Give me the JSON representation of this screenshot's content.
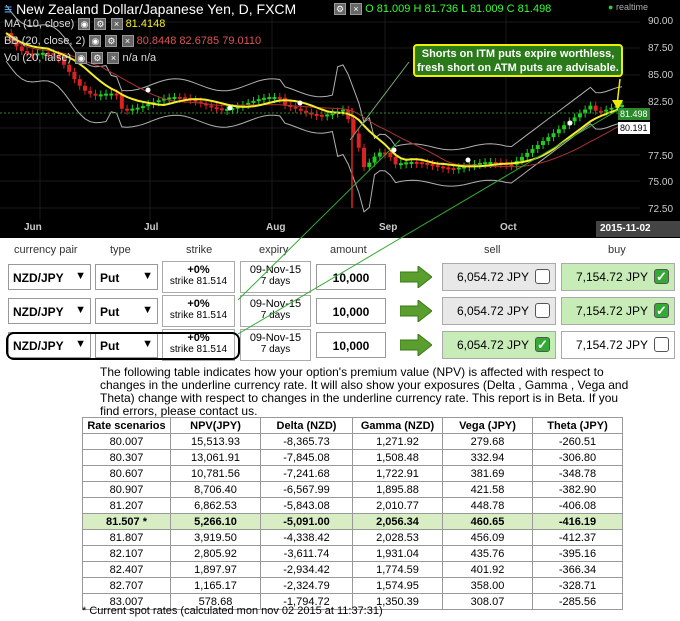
{
  "chart": {
    "title": "New Zealand Dollar/Japanese Yen, D, FXCM",
    "ohlc_o": "O 81.009",
    "ohlc_h": "H 81.736",
    "ohlc_l": "L 81.009",
    "ohlc_c": "C 81.498",
    "realtime": "realtime",
    "legend_ma": "MA (10, close)",
    "legend_ma_val": "81.4148",
    "legend_bb": "BB (20, close, 2)",
    "legend_bb_vals": "80.8448   82.6785  79.0110",
    "legend_vol": "Vol (20, false)",
    "legend_vol_val": "n/a  n/a",
    "annotation": "Shorts on ITM puts expire worthless, fresh short on ATM puts are advisable.",
    "y_ticks": [
      "90.00",
      "87.50",
      "85.00",
      "82.50",
      "77.50",
      "75.00",
      "72.50"
    ],
    "price_tag_last": "81.498",
    "price_tag_ma": "80.191",
    "x_ticks": [
      "Jun",
      "Jul",
      "Aug",
      "Sep",
      "Oct"
    ],
    "date_tag": "2015-11-02",
    "colors": {
      "up": "#22cc22",
      "down": "#dd2222",
      "ma": "#f2ee2a",
      "bb": "#b0b0b0",
      "midband": "#aa3333"
    }
  },
  "options": {
    "headers": {
      "pair": "currency pair",
      "type": "type",
      "strike": "strike",
      "expiry": "expiry",
      "amount": "amount",
      "sell": "sell",
      "buy": "buy"
    },
    "rows": [
      {
        "pair": "NZD/JPY",
        "type": "Put",
        "strike_pct": "+0%",
        "strike": "strike 81.514",
        "expiry": "09-Nov-15",
        "expiry_days": "7 days",
        "amount": "10,000",
        "sell": "6,054.72 JPY",
        "buy": "7,154.72 JPY",
        "sell_checked": false,
        "buy_checked": true
      },
      {
        "pair": "NZD/JPY",
        "type": "Put",
        "strike_pct": "+0%",
        "strike": "strike 81.514",
        "expiry": "09-Nov-15",
        "expiry_days": "7 days",
        "amount": "10,000",
        "sell": "6,054.72 JPY",
        "buy": "7,154.72 JPY",
        "sell_checked": false,
        "buy_checked": true
      },
      {
        "pair": "NZD/JPY",
        "type": "Put",
        "strike_pct": "+0%",
        "strike": "strike 81.514",
        "expiry": "09-Nov-15",
        "expiry_days": "7 days",
        "amount": "10,000",
        "sell": "6,054.72 JPY",
        "buy": "7,154.72 JPY",
        "sell_checked": true,
        "buy_checked": false
      }
    ]
  },
  "description": "The following table indicates how your option's premium value (NPV) is affected with respect to changes in the underline currency rate. It will also show your exposures (Delta , Gamma , Vega and Theta) change with respect to changes in the underline currency rate. This report is in Beta. If you find errors, please contact us.",
  "table": {
    "headers": [
      "Rate scenarios",
      "NPV(JPY)",
      "Delta (NZD)",
      "Gamma (NZD)",
      "Vega (JPY)",
      "Theta (JPY)"
    ],
    "rows": [
      [
        "80.007",
        "15,513.93",
        "-8,365.73",
        "1,271.92",
        "279.68",
        "-260.51"
      ],
      [
        "80.307",
        "13,061.91",
        "-7,845.08",
        "1,508.48",
        "332.94",
        "-306.80"
      ],
      [
        "80.607",
        "10,781.56",
        "-7,241.68",
        "1,722.91",
        "381.69",
        "-348.78"
      ],
      [
        "80.907",
        "8,706.40",
        "-6,567.99",
        "1,895.88",
        "421.58",
        "-382.90"
      ],
      [
        "81.207",
        "6,862.53",
        "-5,843.08",
        "2,010.77",
        "448.78",
        "-406.08"
      ],
      [
        "81.507 *",
        "5,266.10",
        "-5,091.00",
        "2,056.34",
        "460.65",
        "-416.19"
      ],
      [
        "81.807",
        "3,919.50",
        "-4,338.42",
        "2,028.53",
        "456.09",
        "-412.37"
      ],
      [
        "82.107",
        "2,805.92",
        "-3,611.74",
        "1,931.04",
        "435.76",
        "-395.16"
      ],
      [
        "82.407",
        "1,897.97",
        "-2,934.42",
        "1,774.59",
        "401.92",
        "-366.34"
      ],
      [
        "82.707",
        "1,165.17",
        "-2,324.79",
        "1,574.95",
        "358.00",
        "-328.71"
      ],
      [
        "83.007",
        "578.68",
        "-1,794.72",
        "1,350.39",
        "308.07",
        "-285.56"
      ]
    ],
    "spot_row": 5
  },
  "footnote": "* Current spot rates (calculated mon nov 02 2015 at 11:37:31)"
}
